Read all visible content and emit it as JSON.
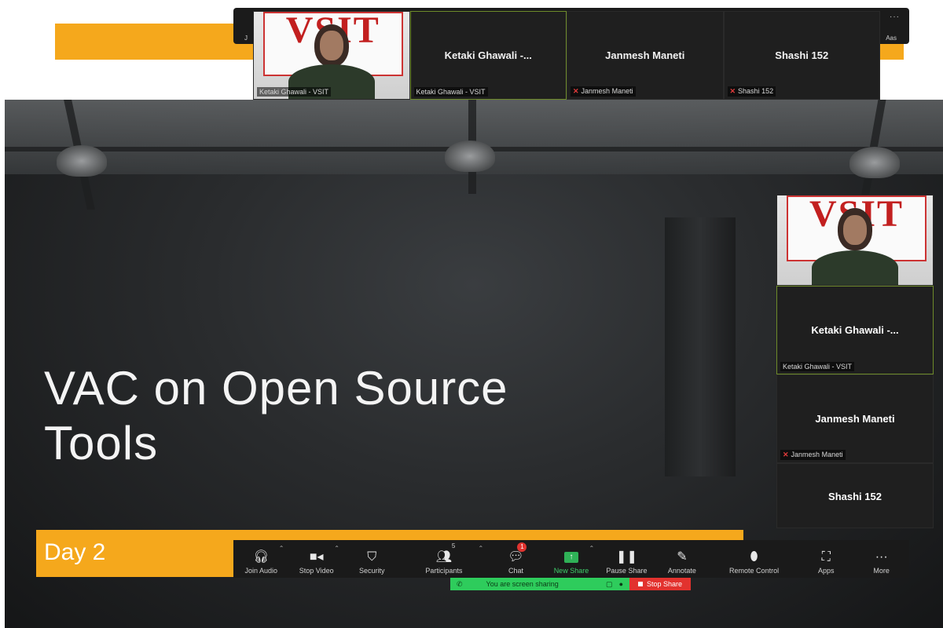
{
  "top_strip": {
    "left_edge_text": "J",
    "more_dots": "···",
    "right_edge_text": "Aas"
  },
  "participants": [
    {
      "display_name": "",
      "tag": "Ketaki Ghawali - VSIT",
      "muted": false,
      "has_video": true
    },
    {
      "display_name": "Ketaki Ghawali -...",
      "tag": "Ketaki Ghawali - VSIT",
      "muted": false,
      "active": true
    },
    {
      "display_name": "Janmesh Maneti",
      "tag": "Janmesh Maneti",
      "muted": true
    },
    {
      "display_name": "Shashi 152",
      "tag": "Shashi 152",
      "muted": true
    }
  ],
  "video_banner_text": "VSIT",
  "slide": {
    "title_line1": "VAC on Open Source",
    "title_line2": "Tools",
    "subtitle": "Day 2"
  },
  "toolbar": {
    "join_audio": "Join Audio",
    "stop_video": "Stop Video",
    "security": "Security",
    "participants": "Participants",
    "participants_count": "5",
    "chat": "Chat",
    "chat_badge": "1",
    "new_share": "New Share",
    "pause_share": "Pause Share",
    "annotate": "Annotate",
    "remote_control": "Remote Control",
    "apps": "Apps",
    "more": "More"
  },
  "share_indicator": {
    "message": "You are screen sharing",
    "stop_label": "Stop Share"
  },
  "colors": {
    "orange": "#f5a81c",
    "share_green": "#2ecc5c",
    "stop_red": "#e2322e",
    "active_border": "#6e8b2a"
  }
}
